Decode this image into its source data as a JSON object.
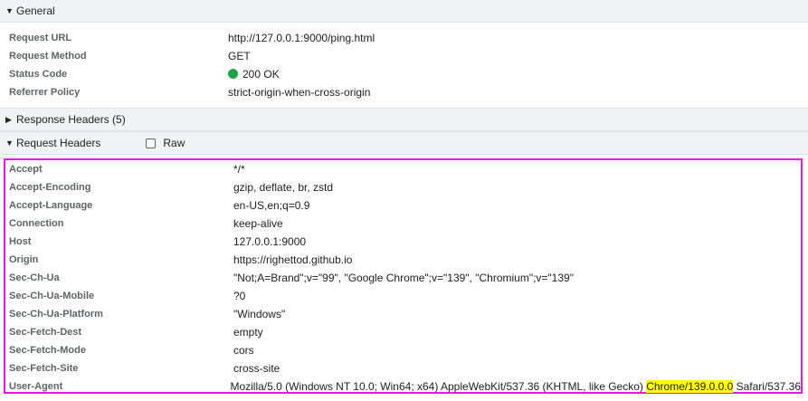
{
  "general": {
    "title": "General",
    "rows": [
      {
        "key": "Request URL",
        "value": "http://127.0.0.1:9000/ping.html"
      },
      {
        "key": "Request Method",
        "value": "GET"
      },
      {
        "key": "Status Code",
        "value": "200 OK"
      },
      {
        "key": "Referrer Policy",
        "value": "strict-origin-when-cross-origin"
      }
    ]
  },
  "response_headers": {
    "title": "Response Headers (5)"
  },
  "request_headers": {
    "title": "Request Headers",
    "raw_label": "Raw",
    "rows": [
      {
        "key": "Accept",
        "value": "*/*"
      },
      {
        "key": "Accept-Encoding",
        "value": "gzip, deflate, br, zstd"
      },
      {
        "key": "Accept-Language",
        "value": "en-US,en;q=0.9"
      },
      {
        "key": "Connection",
        "value": "keep-alive"
      },
      {
        "key": "Host",
        "value": "127.0.0.1:9000"
      },
      {
        "key": "Origin",
        "value": "https://righettod.github.io"
      },
      {
        "key": "Sec-Ch-Ua",
        "value": "\"Not;A=Brand\";v=\"99\", \"Google Chrome\";v=\"139\", \"Chromium\";v=\"139\""
      },
      {
        "key": "Sec-Ch-Ua-Mobile",
        "value": "?0"
      },
      {
        "key": "Sec-Ch-Ua-Platform",
        "value": "\"Windows\""
      },
      {
        "key": "Sec-Fetch-Dest",
        "value": "empty"
      },
      {
        "key": "Sec-Fetch-Mode",
        "value": "cors"
      },
      {
        "key": "Sec-Fetch-Site",
        "value": "cross-site"
      }
    ],
    "user_agent": {
      "key": "User-Agent",
      "prefix": "Mozilla/5.0 (Windows NT 10.0; Win64; x64) AppleWebKit/537.36 (KHTML, like Gecko) ",
      "highlight": "Chrome/139.0.0.0",
      "suffix": " Safari/537.36"
    }
  },
  "colors": {
    "status_ok": "#1ea446",
    "annotation_border": "#e41ce0",
    "highlight": "#ffff00"
  },
  "icons": {
    "expanded": "triangle-down-icon",
    "collapsed": "triangle-right-icon"
  }
}
